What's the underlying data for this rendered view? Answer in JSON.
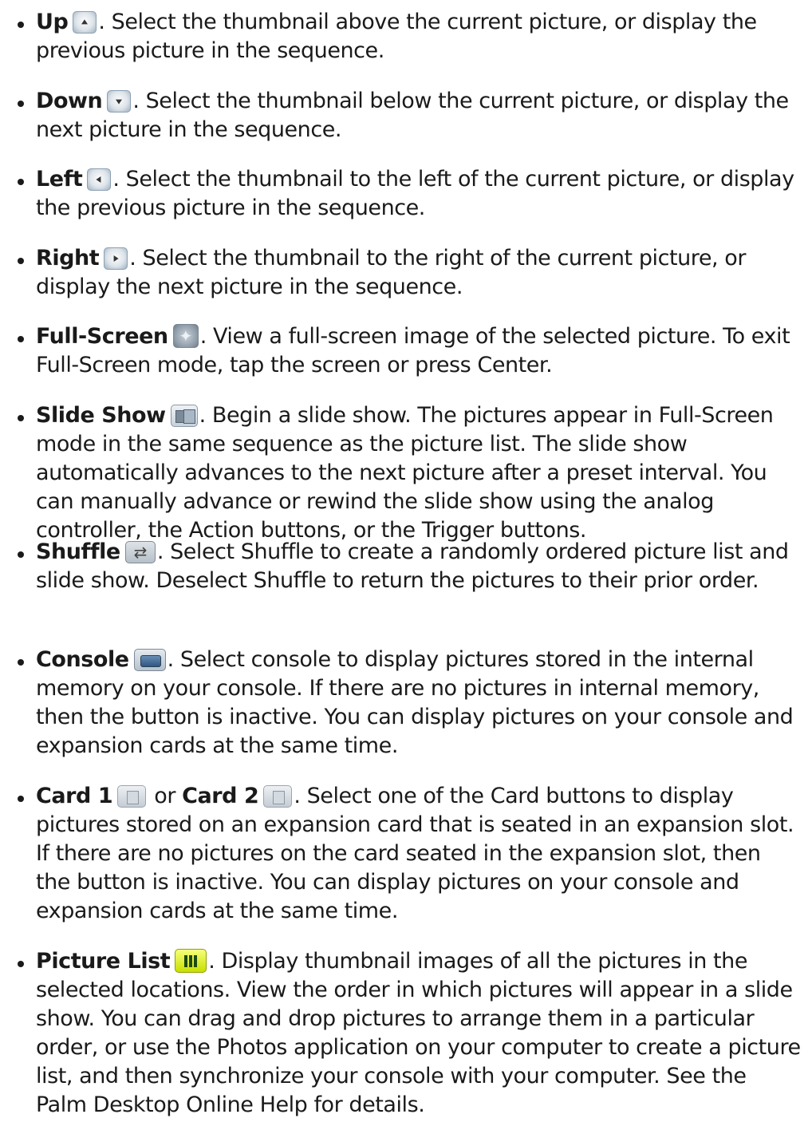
{
  "items": [
    {
      "term": "Up",
      "icon": "up-arrow-button-icon",
      "desc": ". Select the thumbnail above the current picture, or display the previous picture in the sequence."
    },
    {
      "term": "Down",
      "icon": "down-arrow-button-icon",
      "desc": ". Select the thumbnail below the current picture, or display the next picture in the sequence."
    },
    {
      "term": "Left",
      "icon": "left-arrow-button-icon",
      "desc": ". Select the thumbnail to the left of the current picture, or display the previous picture in the sequence."
    },
    {
      "term": "Right",
      "icon": "right-arrow-button-icon",
      "desc": ". Select the thumbnail to the right of the current picture, or display the next picture in the sequence."
    },
    {
      "term": "Full-Screen",
      "icon": "full-screen-button-icon",
      "desc": ". View a full-screen image of the selected picture. To exit Full-Screen mode, tap the screen or press Center."
    },
    {
      "term": "Slide Show",
      "icon": "slide-show-button-icon",
      "desc": ". Begin a slide show. The pictures appear in Full-Screen mode in the same sequence as the picture list. The slide show automatically advances to the next picture after a preset interval. You can manually advance or rewind the slide show using the analog controller, the Action buttons, or the Trigger buttons."
    },
    {
      "term": "Shuffle",
      "icon": "shuffle-button-icon",
      "desc": ". Select Shuffle to create a randomly ordered picture list and slide show. Deselect Shuffle to return the pictures to their prior order."
    },
    {
      "term": "Console",
      "icon": "console-button-icon",
      "desc": ". Select console to display pictures stored in the internal memory on your console. If there are no pictures in internal memory, then the button is inactive. You can display pictures on your console and expansion cards at the same time."
    },
    {
      "term": "Card 1",
      "icon": "card-1-button-icon",
      "joiner": " or ",
      "term2": "Card 2",
      "icon2": "card-2-button-icon",
      "desc": ". Select one of the Card buttons to display pictures stored on an expansion card that is seated in an expansion slot. If there are no pictures on the card seated in the expansion slot, then the button is inactive. You can display pictures on your console and expansion cards at the same time."
    },
    {
      "term": "Picture List",
      "icon": "picture-list-button-icon",
      "desc": ". Display thumbnail images of all the pictures in the selected locations. View the order in which pictures will appear in a slide show. You can drag and drop pictures to arrange them in a particular order, or use the Photos application on your computer to create a picture list, and then synchronize your console with your computer. See the Palm Desktop Online Help for details."
    }
  ]
}
